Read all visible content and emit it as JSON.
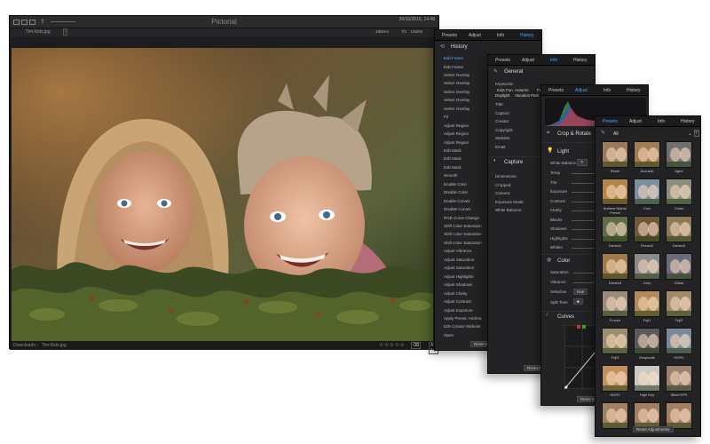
{
  "app": {
    "title": "Pictorial"
  },
  "toolbar": {
    "filename": "Tim-Kids.jpg",
    "datetime": "30/10/2016, 14:48",
    "meta": [
      "180mm",
      "f/4",
      "1/500s"
    ]
  },
  "statusbar": {
    "crumbs": [
      "Downloads",
      "Tim-Kids.jpg"
    ],
    "stars": "☆☆☆☆☆",
    "zoom": "A 1:8"
  },
  "panel_history": {
    "tabs": [
      "Presets",
      "Adjust",
      "Info",
      "History"
    ],
    "active_tab": "History",
    "heading": "History",
    "items": [
      "Edit Frame",
      "Edit Frame",
      "Select Overlay",
      "Select Overlay",
      "Select Overlay",
      "Select Overlay",
      "Select Overlay",
      "Fit",
      "Adjust Region",
      "Adjust Region",
      "Adjust Region",
      "Edit Mask",
      "Edit Mask",
      "Edit Mask",
      "Smooth",
      "Enable Color",
      "Disable Color",
      "Enable Curves",
      "Disable Curves",
      "RGB Curve Change",
      "Shift Color Saturation",
      "Shift Color Saturation",
      "Shift Color Saturation",
      "Adjust Vibrance",
      "Adjust Saturation",
      "Adjust Saturation",
      "Adjust Highlights",
      "Adjust Shadows",
      "Adjust Clarity",
      "Adjust Contrast",
      "Adjust Exposure",
      "Apply Preset: Andrea",
      "Edit Creator Website",
      "Open"
    ],
    "selected_index": 0,
    "reset_label": "Reset Adj"
  },
  "panel_info": {
    "tabs": [
      "Presets",
      "Adjust",
      "Info",
      "History"
    ],
    "active_tab": "Info",
    "general_heading": "General",
    "keywords_label": "Keywords:",
    "keywords": [
      "Kids",
      "Fun",
      "Autumn",
      "Face",
      "Daylight",
      "Vacation",
      "Park"
    ],
    "fields": [
      "Title:",
      "Caption:",
      "Creator:",
      "Copyright:",
      "Website:",
      "Email:"
    ],
    "capture_heading": "Capture",
    "capture_fields": [
      "Dimensions:",
      "Cropped:",
      "Camera:",
      "Exposure Mode:",
      "White Balance:"
    ],
    "reset_label": "Reset Adju"
  },
  "panel_adjust": {
    "tabs": [
      "Presets",
      "Adjust",
      "Info",
      "History"
    ],
    "active_tab": "Adjust",
    "crop_heading": "Crop & Rotate",
    "light_heading": "Light",
    "white_balance_label": "White Balance",
    "light_rows": [
      "Temp",
      "Tint",
      "Exposure",
      "Contrast",
      "Clarity",
      "Blacks",
      "Shadows",
      "Highlights",
      "Whites"
    ],
    "color_heading": "Color",
    "color_rows": [
      "Saturation",
      "Vibrance"
    ],
    "selective_label": "Selective",
    "selective_value": "Hue",
    "split_tone_label": "Split Tone",
    "curves_heading": "Curves",
    "reset_label": "Reset Adj"
  },
  "panel_presets": {
    "tabs": [
      "Presets",
      "Adjust",
      "Info",
      "History"
    ],
    "active_tab": "Presets",
    "filter_value": "All",
    "presets": [
      "Reset",
      "Acoustic",
      "Aged",
      "Andrew Nature Preset",
      "Cool",
      "Cross",
      "Dream1",
      "Dream2",
      "Dream3",
      "Dream4",
      "Grey",
      "Ghost",
      "Frozen",
      "Fuji1",
      "Fuji2",
      "Fuji3",
      "Grayscale",
      "HDR1",
      "HDR2",
      "High Key",
      "Illford HP5",
      "",
      "",
      ""
    ],
    "reset_label": "Reset Adjustments"
  },
  "colors": {
    "accent": "#4aa3ff",
    "panel_bg": "#232325",
    "window_bg": "#1d1d1f"
  }
}
